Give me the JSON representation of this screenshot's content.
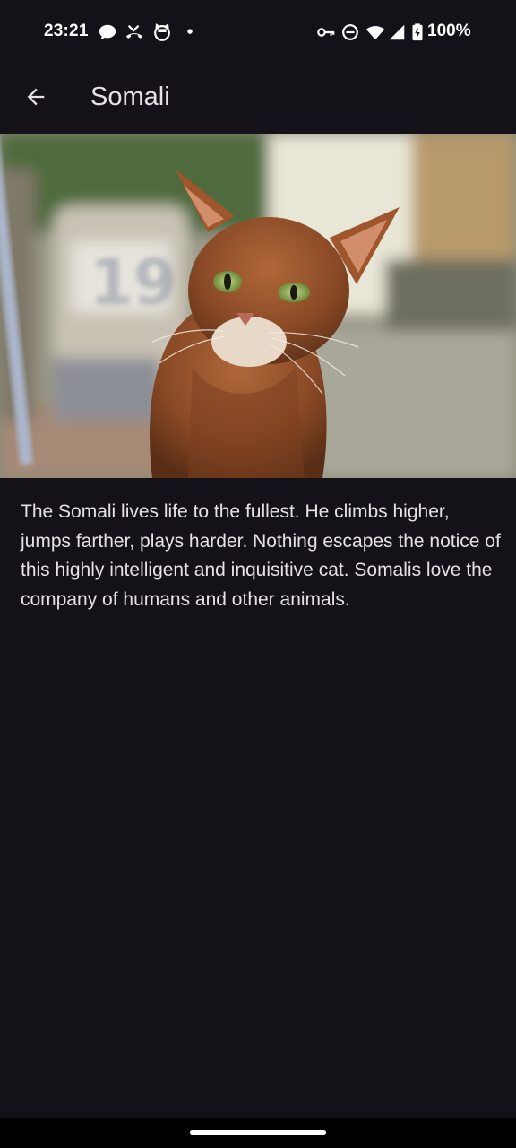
{
  "status_bar": {
    "time": "23:21",
    "notification_icons": [
      "chat-bubble-icon",
      "missed-call-icon",
      "cat-face-icon",
      "more-dot-icon"
    ],
    "system_icons": [
      "vpn-key-icon",
      "do-not-disturb-icon",
      "wifi-icon",
      "cell-signal-icon",
      "battery-charging-icon"
    ],
    "battery": "100%"
  },
  "app_bar": {
    "back_icon": "arrow-back-icon",
    "title": "Somali"
  },
  "content": {
    "image_subject": "cat-photo",
    "description": "The Somali lives life to the fullest. He climbs higher, jumps farther, plays harder. Nothing escapes the notice of this highly intelligent and inquisitive cat. Somalis love the company of humans and other animals."
  },
  "colors": {
    "background": "#141218",
    "on_surface": "#e6e1e5",
    "nav_bar": "#000000"
  }
}
